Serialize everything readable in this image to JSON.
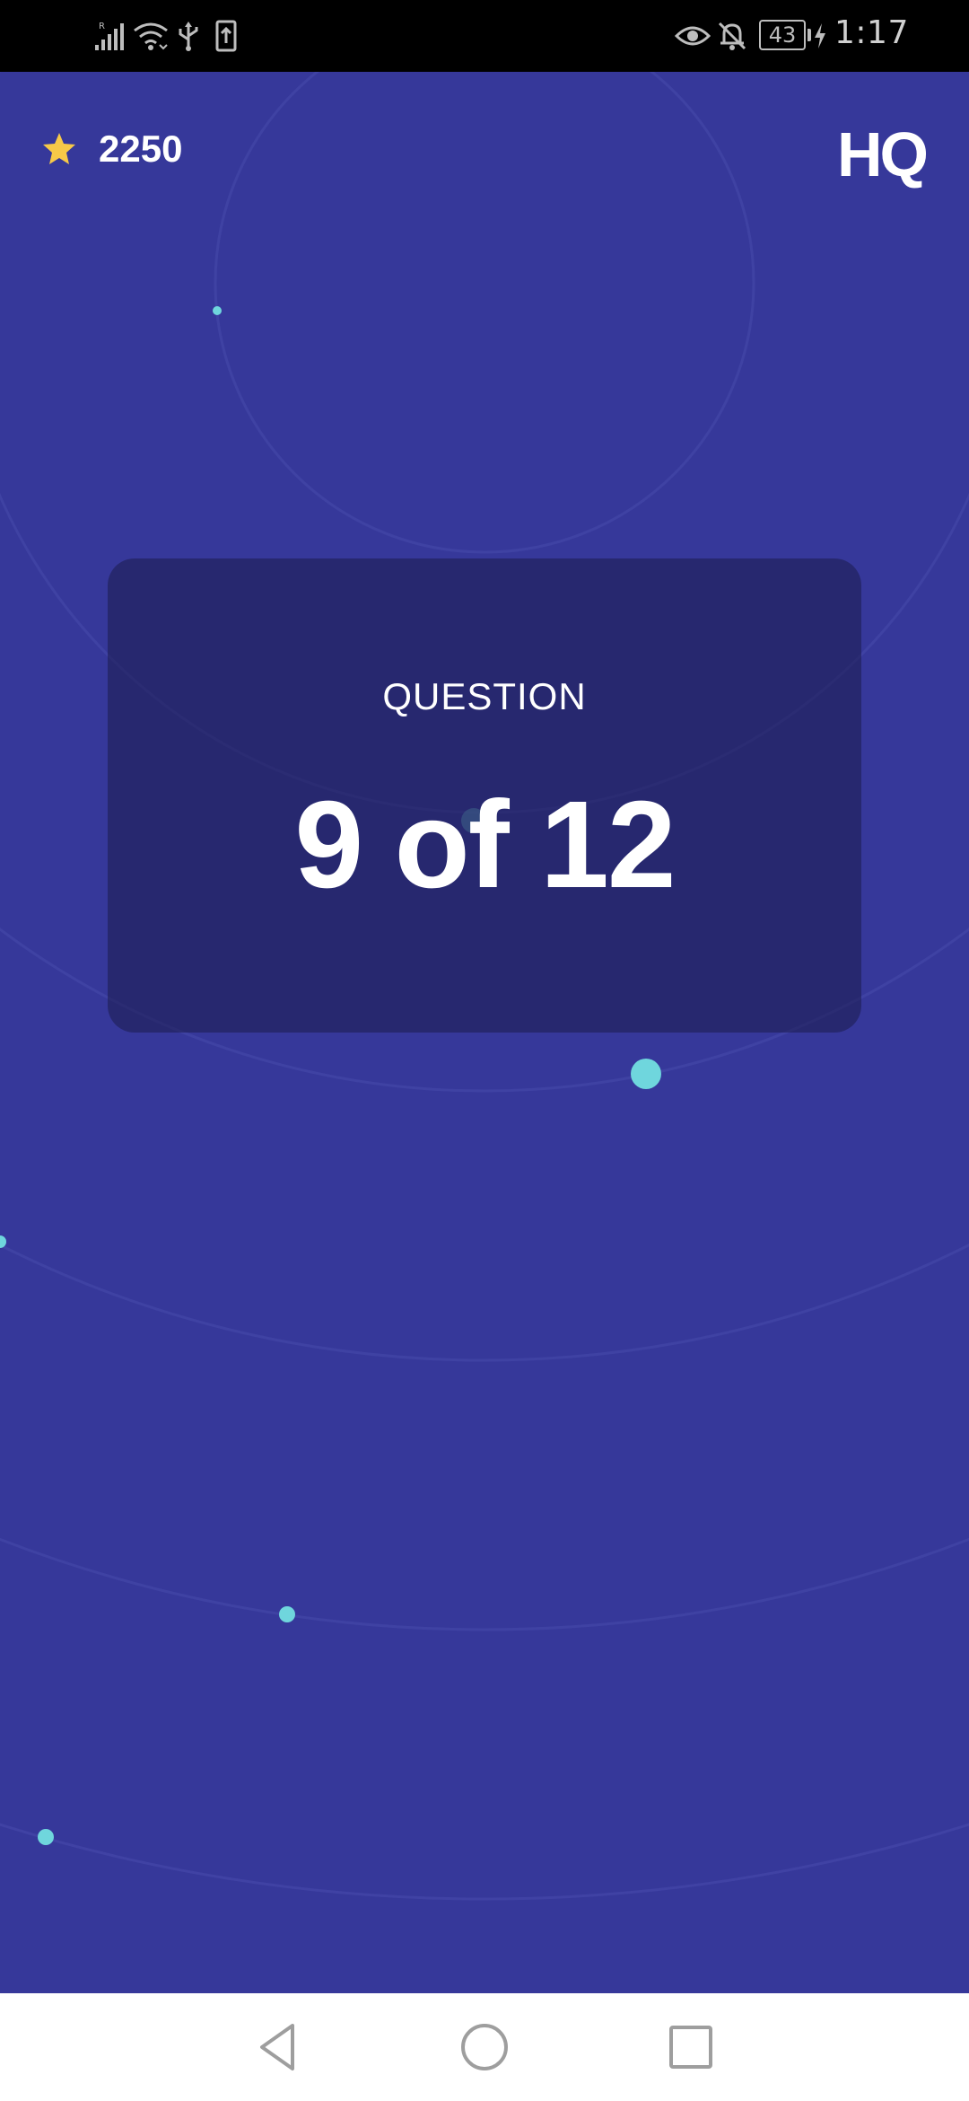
{
  "status_bar": {
    "battery_level": "43",
    "time": "1:17"
  },
  "header": {
    "score": "2250",
    "logo": "HQ",
    "star_color": "#f7c948"
  },
  "question_card": {
    "label": "QUESTION",
    "count": "9 of 12"
  },
  "colors": {
    "background": "#36389a",
    "card": "#25266a",
    "dot": "#6fd6dd"
  },
  "icons": {
    "signal": "signal-icon",
    "wifi": "wifi-icon",
    "usb": "usb-icon",
    "upload": "upload-icon",
    "eye": "eye-icon",
    "bell_off": "bell-off-icon",
    "charging": "charging-icon",
    "star": "star-icon",
    "back": "back-nav-icon",
    "home": "home-nav-icon",
    "recents": "recents-nav-icon"
  }
}
